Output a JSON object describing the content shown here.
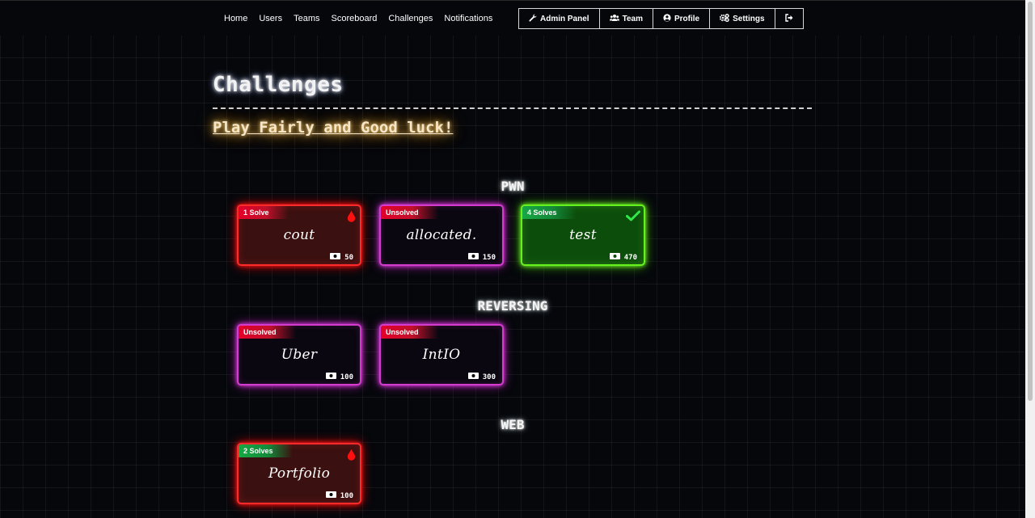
{
  "nav": {
    "links": [
      "Home",
      "Users",
      "Teams",
      "Scoreboard",
      "Challenges",
      "Notifications"
    ],
    "buttons": {
      "admin": "Admin Panel",
      "team": "Team",
      "profile": "Profile",
      "settings": "Settings"
    }
  },
  "page": {
    "title": "Challenges",
    "subtitle": "Play Fairly and Good luck!"
  },
  "categories": [
    {
      "name": "PWN",
      "challenges": [
        {
          "status": "1 Solve",
          "name": "cout",
          "value": "50",
          "style": "red",
          "icon": "blood-drop-icon"
        },
        {
          "status": "Unsolved",
          "name": "allocated.",
          "value": "150",
          "style": "magenta",
          "icon": ""
        },
        {
          "status": "4 Solves",
          "name": "test",
          "value": "470",
          "style": "green",
          "icon": "checkmark-icon"
        }
      ]
    },
    {
      "name": "REVERSING",
      "challenges": [
        {
          "status": "Unsolved",
          "name": "Uber",
          "value": "100",
          "style": "magenta",
          "icon": ""
        },
        {
          "status": "Unsolved",
          "name": "IntIO",
          "value": "300",
          "style": "magenta",
          "icon": ""
        }
      ]
    },
    {
      "name": "WEB",
      "challenges": [
        {
          "status": "2 Solves",
          "name": "Portfolio",
          "value": "100",
          "style": "red",
          "icon": "blood-drop-icon"
        }
      ]
    }
  ],
  "colors": {
    "background": "#05070b",
    "first_blood_red": "#ff2a2a",
    "unsolved_magenta": "#d43cd0",
    "solved_green": "#66f21f",
    "subtitle_glow": "#e6a62d"
  }
}
